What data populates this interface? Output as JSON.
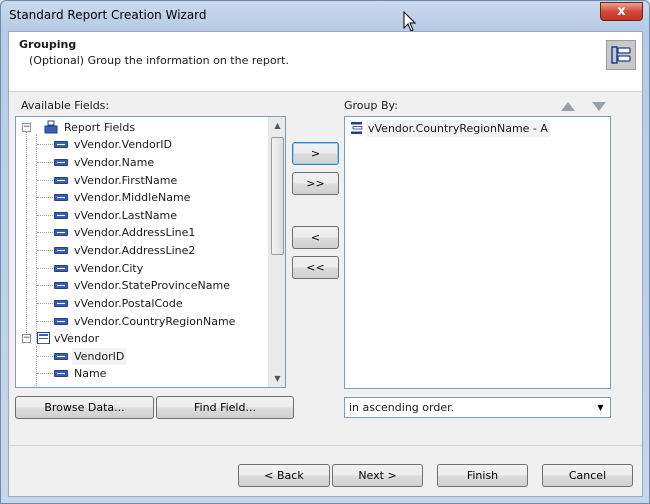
{
  "window": {
    "title": "Standard Report Creation Wizard",
    "close_glyph": "x"
  },
  "header": {
    "title": "Grouping",
    "subtitle": "(Optional) Group the information on the report.",
    "icon": "grouping-icon"
  },
  "available_fields": {
    "label": "Available Fields:",
    "root_label": "Report Fields",
    "report_fields": [
      "vVendor.VendorID",
      "vVendor.Name",
      "vVendor.FirstName",
      "vVendor.MiddleName",
      "vVendor.LastName",
      "vVendor.AddressLine1",
      "vVendor.AddressLine2",
      "vVendor.City",
      "vVendor.StateProvinceName",
      "vVendor.PostalCode",
      "vVendor.CountryRegionName"
    ],
    "table_label": "vVendor",
    "table_fields": [
      "VendorID",
      "Name"
    ]
  },
  "group_by": {
    "label": "Group By:",
    "items": [
      "vVendor.CountryRegionName - A"
    ],
    "order_value": "in ascending order."
  },
  "transfer_buttons": {
    "add": ">",
    "add_all": ">>",
    "remove": "<",
    "remove_all": "<<"
  },
  "field_buttons": {
    "browse": "Browse Data...",
    "find": "Find Field..."
  },
  "footer": {
    "back": "< Back",
    "next": "Next >",
    "finish": "Finish",
    "cancel": "Cancel"
  }
}
